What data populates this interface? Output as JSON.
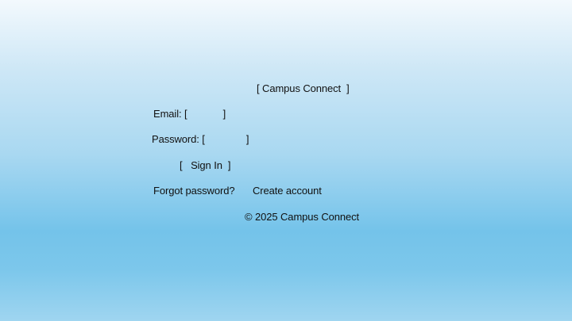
{
  "header": {
    "title": "Campus Connect"
  },
  "form": {
    "email_label": "Email:",
    "email_value": "",
    "password_label": "Password:",
    "password_value": "",
    "signin_label": "Sign In"
  },
  "links": {
    "forgot": "Forgot password?",
    "create": "Create account"
  },
  "footer": {
    "copyright": "© 2025 Campus Connect"
  }
}
